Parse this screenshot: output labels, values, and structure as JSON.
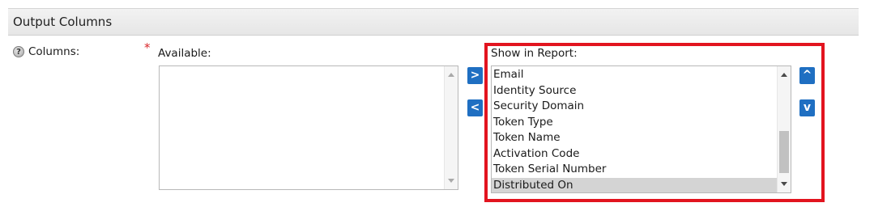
{
  "section": {
    "title": "Output Columns"
  },
  "columns_field": {
    "label": "Columns:",
    "help_glyph": "?",
    "required_marker": "*"
  },
  "available": {
    "label": "Available:",
    "items": []
  },
  "show_in_report": {
    "label": "Show in Report:",
    "items": [
      {
        "label": "Email",
        "selected": false
      },
      {
        "label": "Identity Source",
        "selected": false
      },
      {
        "label": "Security Domain",
        "selected": false
      },
      {
        "label": "Token Type",
        "selected": false
      },
      {
        "label": "Token Name",
        "selected": false
      },
      {
        "label": "Activation Code",
        "selected": false
      },
      {
        "label": "Token Serial Number",
        "selected": false
      },
      {
        "label": "Distributed On",
        "selected": true
      }
    ]
  },
  "buttons": {
    "add": ">",
    "remove": "<",
    "move_up": "^",
    "move_down": "v"
  },
  "colors": {
    "accent_button": "#1f6fc2",
    "highlight_border": "#e2141f",
    "required": "#d9262a",
    "selected_row": "#d4d4d4"
  }
}
